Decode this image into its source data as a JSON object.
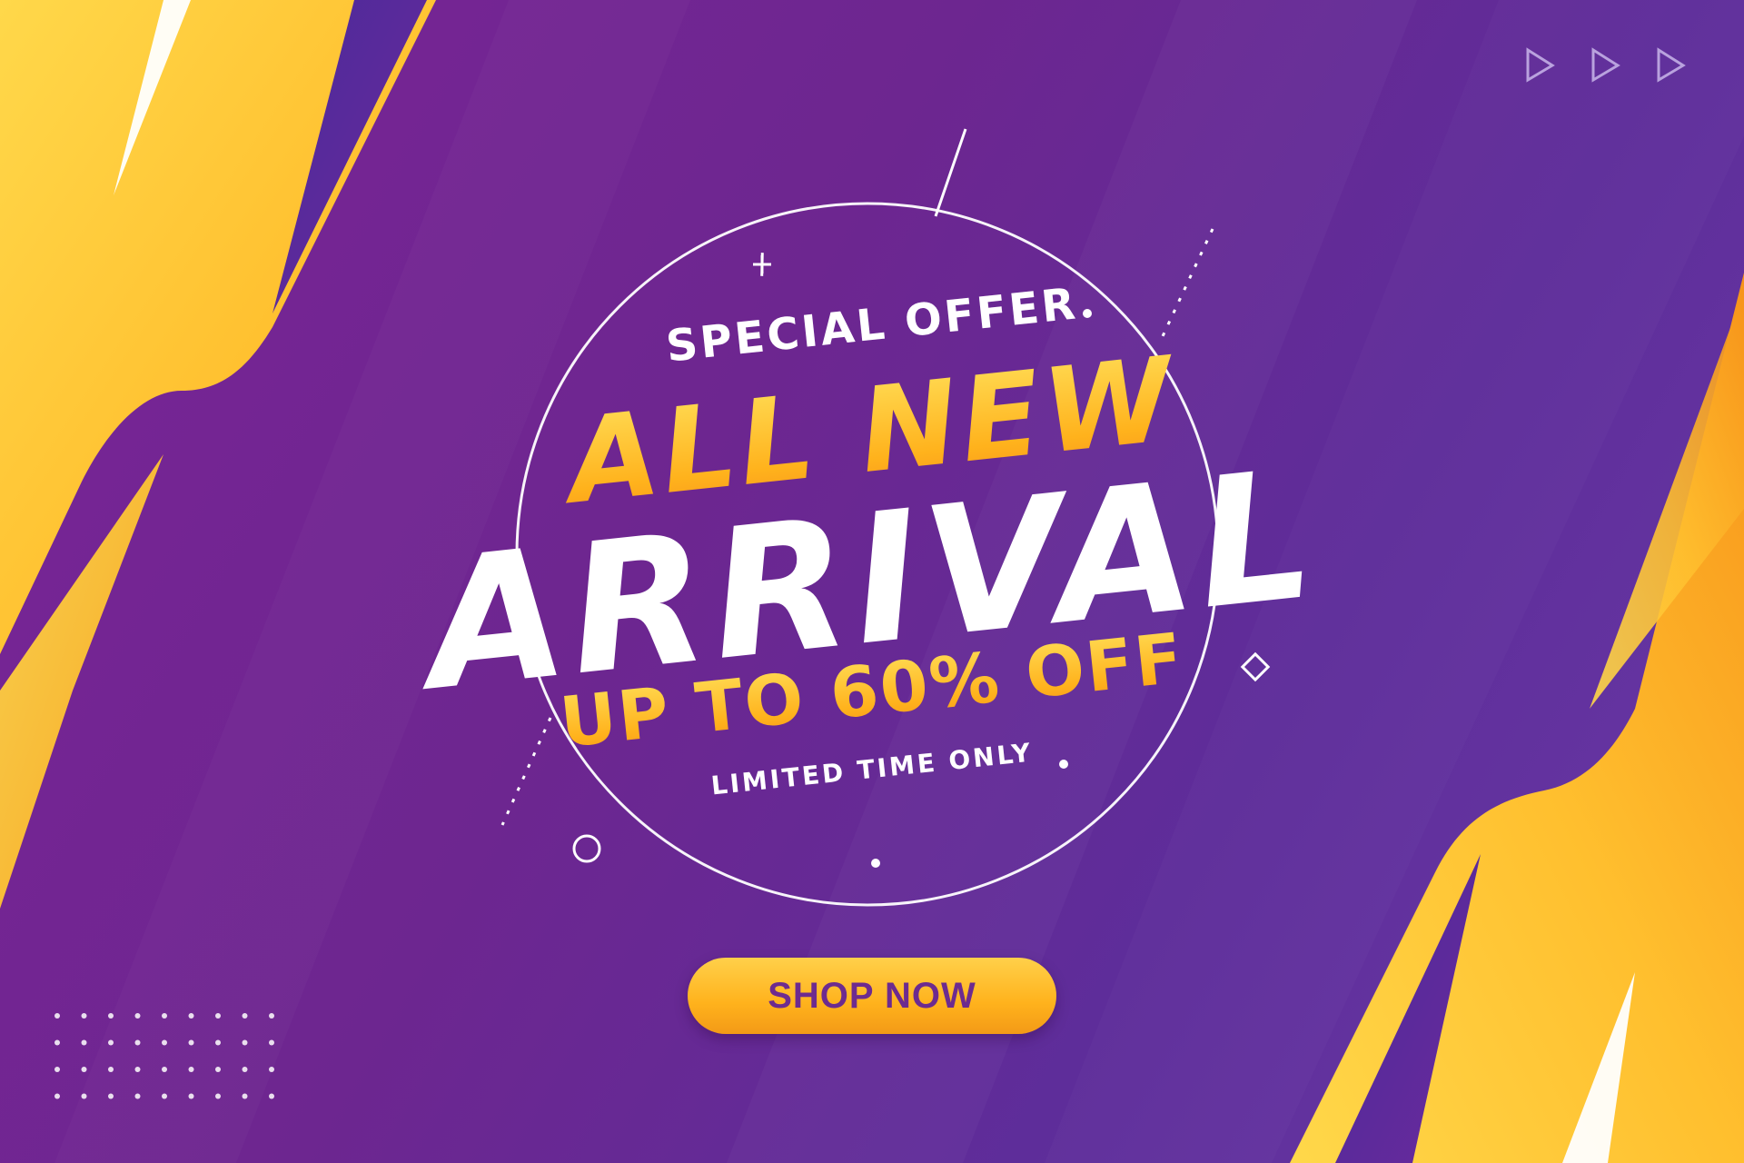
{
  "banner": {
    "eyebrow": "SPECIAL OFFER",
    "headline_top": "ALL NEW",
    "headline_main": "ARRIVAL",
    "discount": "UP TO 60% OFF",
    "tagline": "LIMITED TIME ONLY",
    "cta_label": "SHOP NOW"
  },
  "colors": {
    "background": "#6d2690",
    "accent_yellow": "#ffc531",
    "accent_orange": "#f7951a",
    "text_white": "#ffffff",
    "cta_text": "#6d2b8f"
  },
  "icons": [
    "play-triangle-icon",
    "play-triangle-icon",
    "play-triangle-icon",
    "plus-icon",
    "diamond-icon",
    "ring-icon"
  ]
}
